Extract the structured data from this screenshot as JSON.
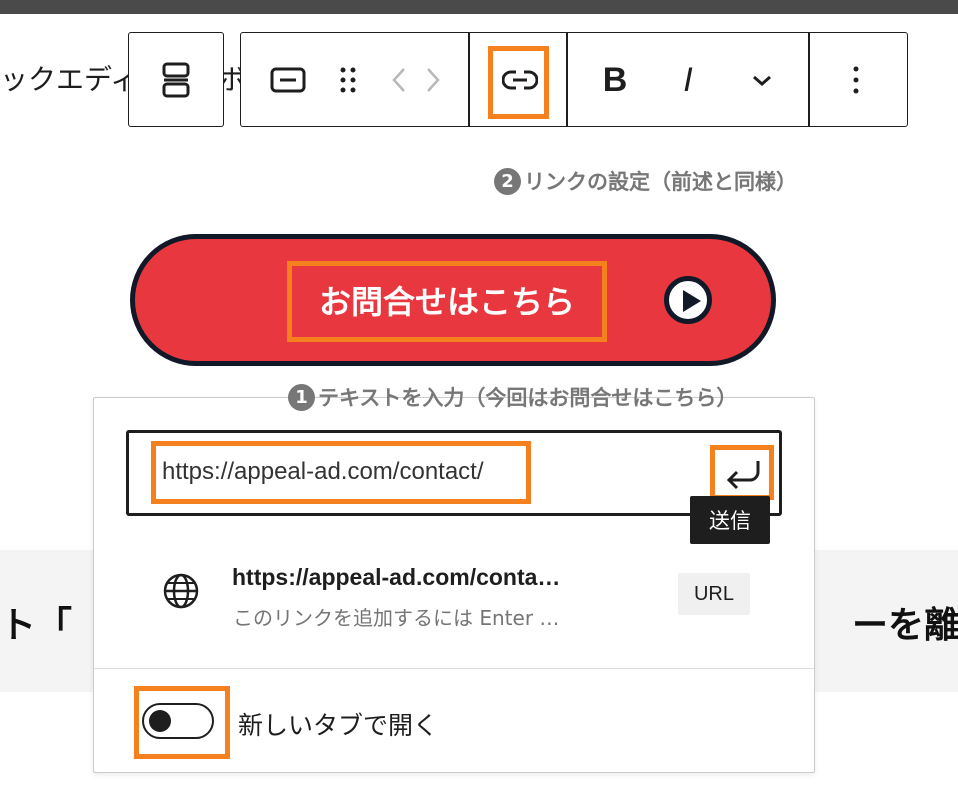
{
  "background": {
    "editor_text": "ックエディ",
    "editor_text_end": "ボ",
    "heading_left": "ト「",
    "heading_right": "ーを離"
  },
  "toolbar": {
    "groups": [
      "block-type",
      "block-tools",
      "link",
      "format",
      "more"
    ],
    "icons": [
      "stack-icon",
      "button-block-icon",
      "drag-handle-icon",
      "chevron-left-icon",
      "chevron-right-icon",
      "link-icon",
      "bold-icon",
      "italic-icon",
      "chevron-down-icon",
      "more-vertical-icon"
    ],
    "bold_label": "B",
    "italic_label": "I"
  },
  "annotations": {
    "step2_number": "2",
    "step2_text": "リンクの設定（前述と同様）",
    "step1_number": "1",
    "step1_text": "テキストを入力（今回はお問合せはこちら）"
  },
  "cta": {
    "label": "お問合せはこちら"
  },
  "link_popover": {
    "url_value": "https://appeal-ad.com/contact/",
    "submit_tooltip": "送信",
    "suggestion_title": "https://appeal-ad.com/conta…",
    "suggestion_subtitle": "このリンクを追加するには Enter …",
    "suggestion_badge": "URL",
    "new_tab_label": "新しいタブで開く",
    "new_tab_enabled": false
  },
  "colors": {
    "highlight": "#f5801e",
    "cta_fill": "#e8373e",
    "cta_border": "#111828",
    "annotation": "#777777",
    "dark": "#1e1e1e"
  }
}
